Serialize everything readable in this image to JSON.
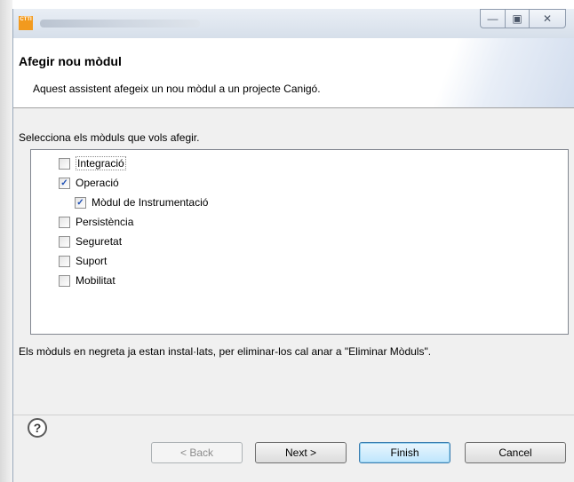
{
  "titlebar": {
    "app_icon_text": "CTTI",
    "minimize_glyph": "—",
    "maximize_glyph": "▣",
    "close_glyph": "✕"
  },
  "header": {
    "title": "Afegir nou mòdul",
    "description": "Aquest assistent afegeix un nou mòdul a un projecte Canigó."
  },
  "instruction": "Selecciona els mòduls que vols afegir.",
  "tree": [
    {
      "label": "Integració",
      "checked": false,
      "level": 0,
      "focused": true
    },
    {
      "label": "Operació",
      "checked": true,
      "level": 0,
      "focused": false
    },
    {
      "label": "Mòdul de Instrumentació",
      "checked": true,
      "level": 1,
      "focused": false
    },
    {
      "label": "Persistència",
      "checked": false,
      "level": 0,
      "focused": false
    },
    {
      "label": "Seguretat",
      "checked": false,
      "level": 0,
      "focused": false
    },
    {
      "label": "Suport",
      "checked": false,
      "level": 0,
      "focused": false
    },
    {
      "label": "Mobilitat",
      "checked": false,
      "level": 0,
      "focused": false
    }
  ],
  "note": "Els mòduls en negreta ja estan instal·lats, per eliminar-los cal anar a \"Eliminar Mòduls\".",
  "help_glyph": "?",
  "buttons": {
    "back": "< Back",
    "next": "Next >",
    "finish": "Finish",
    "cancel": "Cancel"
  },
  "icons": {
    "help": "help-icon",
    "app": "ctti-logo-icon"
  },
  "colors": {
    "accent": "#3c7fb1",
    "logo": "#f29a1e"
  }
}
